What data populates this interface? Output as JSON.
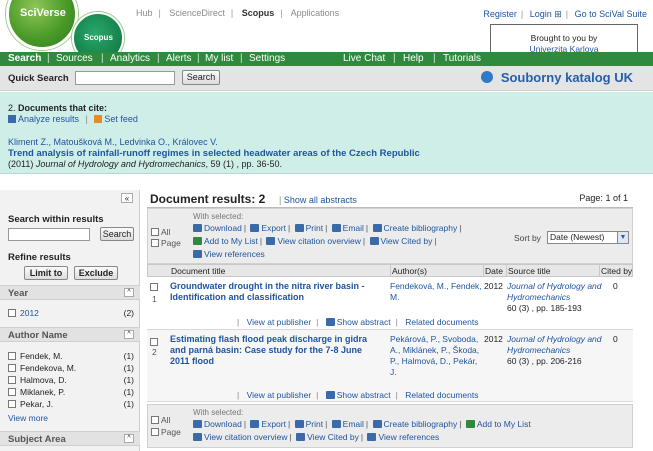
{
  "brand": {
    "logo_main": "SciVerse",
    "logo_sub": "Scopus"
  },
  "top_links": [
    "Hub",
    "ScienceDirect",
    "Scopus",
    "Applications"
  ],
  "top_links_active": "Scopus",
  "right_links": [
    "Register",
    "Login ⊞",
    "Go to SciVal Suite"
  ],
  "brought": {
    "line1": "Brought to you by",
    "line2": "Univerzita Karlova"
  },
  "nav": {
    "items": [
      "Search",
      "Sources",
      "Analytics",
      "Alerts",
      "My list",
      "Settings"
    ],
    "right_items": [
      "Live Chat",
      "Help",
      "Tutorials"
    ]
  },
  "quick_search": {
    "label": "Quick Search",
    "button": "Search",
    "catalog": "Souborny katalog UK"
  },
  "cite_box": {
    "count_text": "2",
    "heading": "Documents that cite:",
    "analyze": "Analyze results",
    "set_feed": "Set feed",
    "authors": "Kliment Z., Matoušková M., Ledvinka O., Královec V.",
    "title": "Trend analysis of rainfall-runoff regimes in selected headwater areas of the Czech Republic",
    "source_year": "(2011)",
    "source_journal": "Journal of Hydrology and Hydromechanics",
    "source_rest": ", 59 (1) , pp. 36-50."
  },
  "sidebar": {
    "collapse": "«",
    "search_within": "Search within results",
    "search_btn": "Search",
    "refine": "Refine results",
    "limit_btn": "Limit to",
    "exclude_btn": "Exclude",
    "facets": {
      "year": {
        "title": "Year",
        "items": [
          {
            "label": "2012",
            "count": "(2)"
          }
        ]
      },
      "author": {
        "title": "Author Name",
        "items": [
          {
            "label": "Fendek, M.",
            "count": "(1)"
          },
          {
            "label": "Fendekova, M.",
            "count": "(1)"
          },
          {
            "label": "Halmova, D.",
            "count": "(1)"
          },
          {
            "label": "Miklanek, P.",
            "count": "(1)"
          },
          {
            "label": "Pekar, J.",
            "count": "(1)"
          }
        ],
        "more": "View more"
      },
      "subject": {
        "title": "Subject Area"
      }
    }
  },
  "results": {
    "title": "Document results: 2",
    "show_abstracts": "Show all abstracts",
    "page_label": "Page:",
    "page_value": "1",
    "page_of": "of 1",
    "all_label": "All",
    "page_cb_label": "Page",
    "with_selected": "With selected:",
    "actions_top_line1": [
      "Download",
      "Export",
      "Print",
      "Email",
      "Create bibliography"
    ],
    "actions_top_line2": [
      "Add to My List",
      "View citation overview",
      "View Cited by"
    ],
    "actions_top_line3": [
      "View references"
    ],
    "actions_bottom_line1": [
      "Download",
      "Export",
      "Print",
      "Email",
      "Create bibliography",
      "Add to My List"
    ],
    "actions_bottom_line2": [
      "View citation overview",
      "View Cited by",
      "View references"
    ],
    "sort_label": "Sort by",
    "sort_value": "Date (Newest)",
    "columns": [
      "Document title",
      "Author(s)",
      "Date",
      "Source title",
      "Cited by"
    ],
    "rows": [
      {
        "num": "1",
        "title": "Groundwater drought in the nitra river basin - Identification and classification",
        "authors": "Fendeková, M., Fendek, M.",
        "date": "2012",
        "journal": "Journal of Hydrology and Hydromechanics",
        "source_detail": "60 (3) , pp. 185-193",
        "cited": "0",
        "links": [
          "View at publisher",
          "Show abstract",
          "Related documents"
        ]
      },
      {
        "num": "2",
        "title": "Estimating flash flood peak discharge in gidra and parná basin: Case study for the 7-8 June 2011 flood",
        "authors": "Pekárová, P., Svoboda, A., Miklánek, P., Škoda, P., Halmová, D., Pekár, J.",
        "date": "2012",
        "journal": "Journal of Hydrology and Hydromechanics",
        "source_detail": "60 (3) , pp. 206-216",
        "cited": "0",
        "links": [
          "View at publisher",
          "Show abstract",
          "Related documents"
        ]
      }
    ]
  }
}
